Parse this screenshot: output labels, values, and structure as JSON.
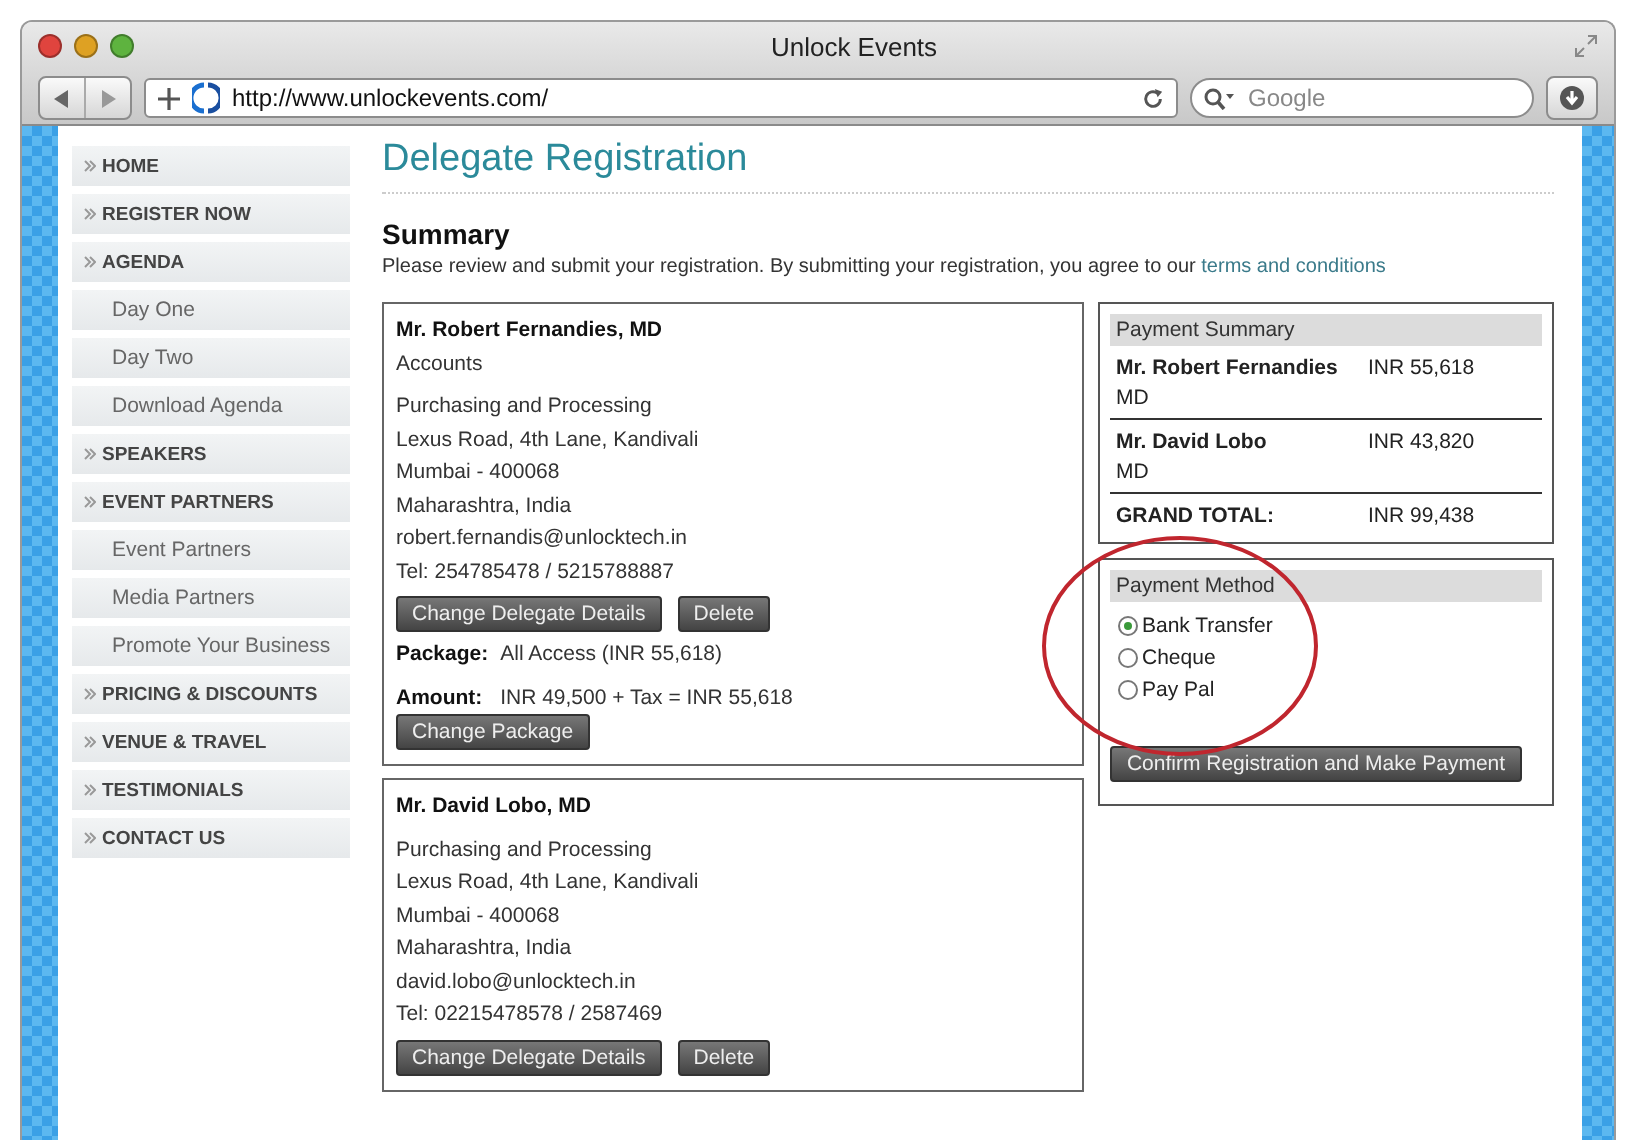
{
  "window": {
    "title": "Unlock Events",
    "url": "http://www.unlockevents.com/",
    "search": {
      "placeholder": "Google"
    }
  },
  "sidebar": {
    "items": [
      {
        "label": "HOME",
        "kind": "section"
      },
      {
        "label": "REGISTER NOW",
        "kind": "section"
      },
      {
        "label": "AGENDA",
        "kind": "section"
      },
      {
        "label": "Day One",
        "kind": "sub"
      },
      {
        "label": "Day Two",
        "kind": "sub"
      },
      {
        "label": "Download Agenda",
        "kind": "sub"
      },
      {
        "label": "SPEAKERS",
        "kind": "section"
      },
      {
        "label": "EVENT PARTNERS",
        "kind": "section"
      },
      {
        "label": "Event Partners",
        "kind": "sub"
      },
      {
        "label": "Media Partners",
        "kind": "sub"
      },
      {
        "label": "Promote Your Business",
        "kind": "sub"
      },
      {
        "label": "PRICING & DISCOUNTS",
        "kind": "section"
      },
      {
        "label": "VENUE & TRAVEL",
        "kind": "section"
      },
      {
        "label": "TESTIMONIALS",
        "kind": "section"
      },
      {
        "label": "CONTACT US",
        "kind": "section"
      }
    ]
  },
  "page_title": "Delegate Registration",
  "summary": {
    "title": "Summary",
    "intro": "Please review and submit your registration. By submitting your registration, you agree to our",
    "link": "terms and conditions"
  },
  "delegates": [
    {
      "name": "Mr. Robert  Fernandies, MD",
      "department": "Accounts",
      "address": [
        "Purchasing and Processing",
        "Lexus Road, 4th Lane, Kandivali",
        "Mumbai - 400068",
        "Maharashtra,  India",
        "robert.fernandis@unlocktech.in",
        "Tel: 254785478  /  5215788887"
      ],
      "buttons": [
        "Change Delegate Details",
        "Delete"
      ],
      "package": {
        "label": "Package:",
        "value": "All Access (INR 55,618)"
      },
      "amount": {
        "label": "Amount:",
        "value": "INR  49,500 + Tax =  INR  55,618"
      },
      "package_button": "Change Package"
    },
    {
      "name": "Mr. David  Lobo, MD",
      "address": [
        "Purchasing and Processing",
        "Lexus Road, 4th Lane, Kandivali",
        "Mumbai - 400068",
        "Maharashtra,  India",
        "david.lobo@unlocktech.in",
        "Tel: 02215478578  /  2587469"
      ],
      "buttons": [
        "Change Delegate Details",
        "Delete"
      ]
    }
  ],
  "payment_summary": {
    "title": "Payment Summary",
    "rows": [
      {
        "name": "Mr. Robert  Fernandies",
        "suffix": "MD",
        "amount": "INR  55,618"
      },
      {
        "name": "Mr. David  Lobo",
        "suffix": "MD",
        "amount": "INR  43,820"
      }
    ],
    "total": {
      "label": "GRAND TOTAL:",
      "amount": "INR  99,438"
    }
  },
  "payment_method": {
    "title": "Payment Method",
    "options": [
      {
        "label": "Bank Transfer",
        "selected": true
      },
      {
        "label": "Cheque",
        "selected": false
      },
      {
        "label": "Pay Pal",
        "selected": false
      }
    ],
    "button": "Confirm Registration and Make Payment"
  }
}
